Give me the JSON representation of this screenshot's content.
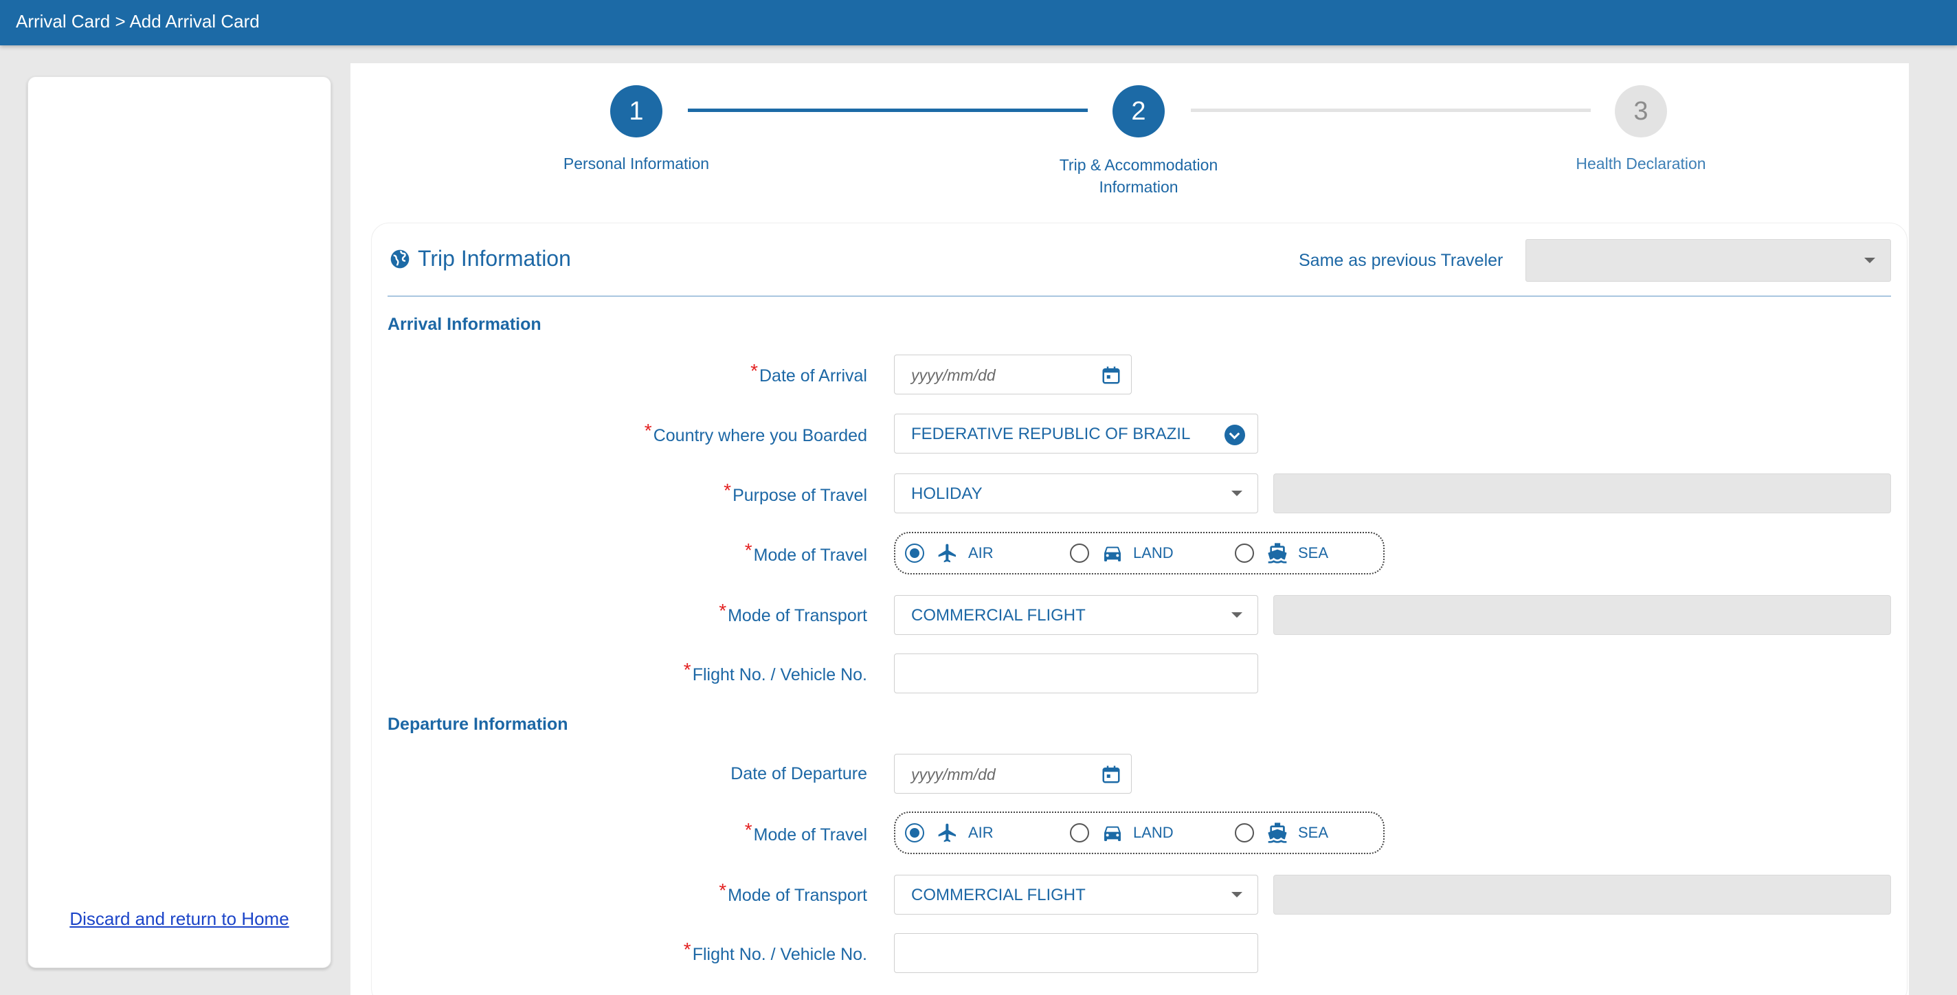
{
  "header": {
    "breadcrumb": "Arrival Card > Add Arrival Card"
  },
  "sidebar": {
    "discard_link": "Discard and return to Home"
  },
  "stepper": {
    "steps": [
      {
        "number": "1",
        "label": "Personal Information",
        "state": "done"
      },
      {
        "number": "2",
        "label_line1": "Trip & Accommodation",
        "label_line2": "Information",
        "state": "active"
      },
      {
        "number": "3",
        "label": "Health Declaration",
        "state": "upcoming"
      }
    ]
  },
  "trip": {
    "title": "Trip Information",
    "same_as_label": "Same as previous Traveler",
    "same_as_value": "",
    "arrival": {
      "heading": "Arrival Information",
      "date_label": "Date of Arrival",
      "date_placeholder": "yyyy/mm/dd",
      "country_label": "Country where you Boarded",
      "country_value": "FEDERATIVE REPUBLIC OF BRAZIL",
      "purpose_label": "Purpose of Travel",
      "purpose_value": "HOLIDAY",
      "mode_label": "Mode of Travel",
      "modes": [
        "AIR",
        "LAND",
        "SEA"
      ],
      "mode_selected": "AIR",
      "transport_label": "Mode of Transport",
      "transport_value": "COMMERCIAL FLIGHT",
      "flight_label": "Flight No. / Vehicle No.",
      "flight_value": ""
    },
    "departure": {
      "heading": "Departure Information",
      "date_label": "Date of Departure",
      "date_placeholder": "yyyy/mm/dd",
      "mode_label": "Mode of Travel",
      "modes": [
        "AIR",
        "LAND",
        "SEA"
      ],
      "mode_selected": "AIR",
      "transport_label": "Mode of Transport",
      "transport_value": "COMMERCIAL FLIGHT",
      "flight_label": "Flight No. / Vehicle No.",
      "flight_value": ""
    }
  },
  "colors": {
    "primary": "#1c6aa6",
    "required": "#e32121",
    "link": "#1b44c8"
  },
  "icons": [
    "globe-icon",
    "calendar-icon",
    "airplane-icon",
    "car-icon",
    "ship-icon",
    "chevron-down-icon"
  ]
}
